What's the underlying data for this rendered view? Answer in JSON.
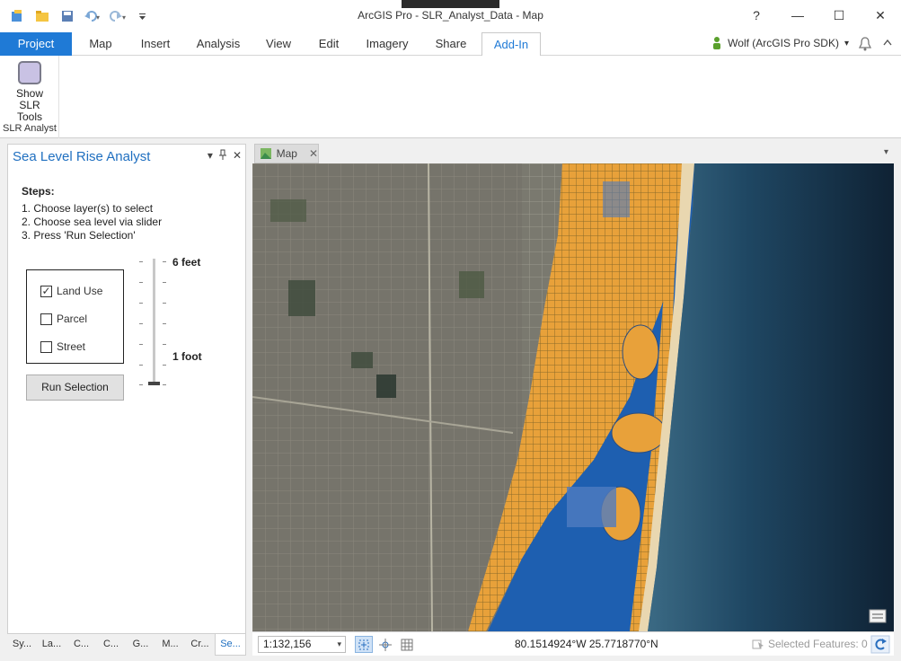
{
  "window": {
    "title": "ArcGIS Pro - SLR_Analyst_Data - Map"
  },
  "quick_access": {
    "icons": [
      "new-project-icon",
      "open-project-icon",
      "save-icon",
      "undo-icon",
      "redo-icon",
      "customize-icon"
    ]
  },
  "window_controls": {
    "help": "?",
    "minimize": "—",
    "maximize": "☐",
    "close": "✕"
  },
  "ribbon": {
    "tabs": [
      "Project",
      "Map",
      "Insert",
      "Analysis",
      "View",
      "Edit",
      "Imagery",
      "Share",
      "Add-In"
    ],
    "active_tab": "Add-In",
    "user": "Wolf (ArcGIS Pro SDK)",
    "user_dropdown": "▾",
    "group": {
      "button_label_line1": "Show",
      "button_label_line2": "SLR Tools",
      "group_label": "SLR Analyst"
    }
  },
  "pane": {
    "title": "Sea Level Rise Analyst",
    "steps_heading": "Steps:",
    "steps": [
      "1. Choose layer(s) to select",
      "2. Choose sea level via slider",
      "3. Press 'Run Selection'"
    ],
    "layers": [
      {
        "label": "Land Use",
        "checked": true,
        "mark": "✓"
      },
      {
        "label": "Parcel",
        "checked": false,
        "mark": ""
      },
      {
        "label": "Street",
        "checked": false,
        "mark": ""
      }
    ],
    "run_button": "Run Selection",
    "slider": {
      "top_label": "6 feet",
      "bottom_label": "1 foot",
      "min_feet": 1,
      "max_feet": 6,
      "value_feet": 1
    },
    "bottom_tabs": [
      "Sy...",
      "La...",
      "C...",
      "C...",
      "G...",
      "M...",
      "Cr...",
      "Se..."
    ],
    "active_bottom_tab": "Se..."
  },
  "map": {
    "tab_label": "Map",
    "tab_close": "✕",
    "dropdown": "▾",
    "scale": "1:132,156",
    "scale_dropdown": "▾",
    "coordinates": "80.1514924°W 25.7718770°N",
    "selected_features": "Selected Features: 0"
  }
}
